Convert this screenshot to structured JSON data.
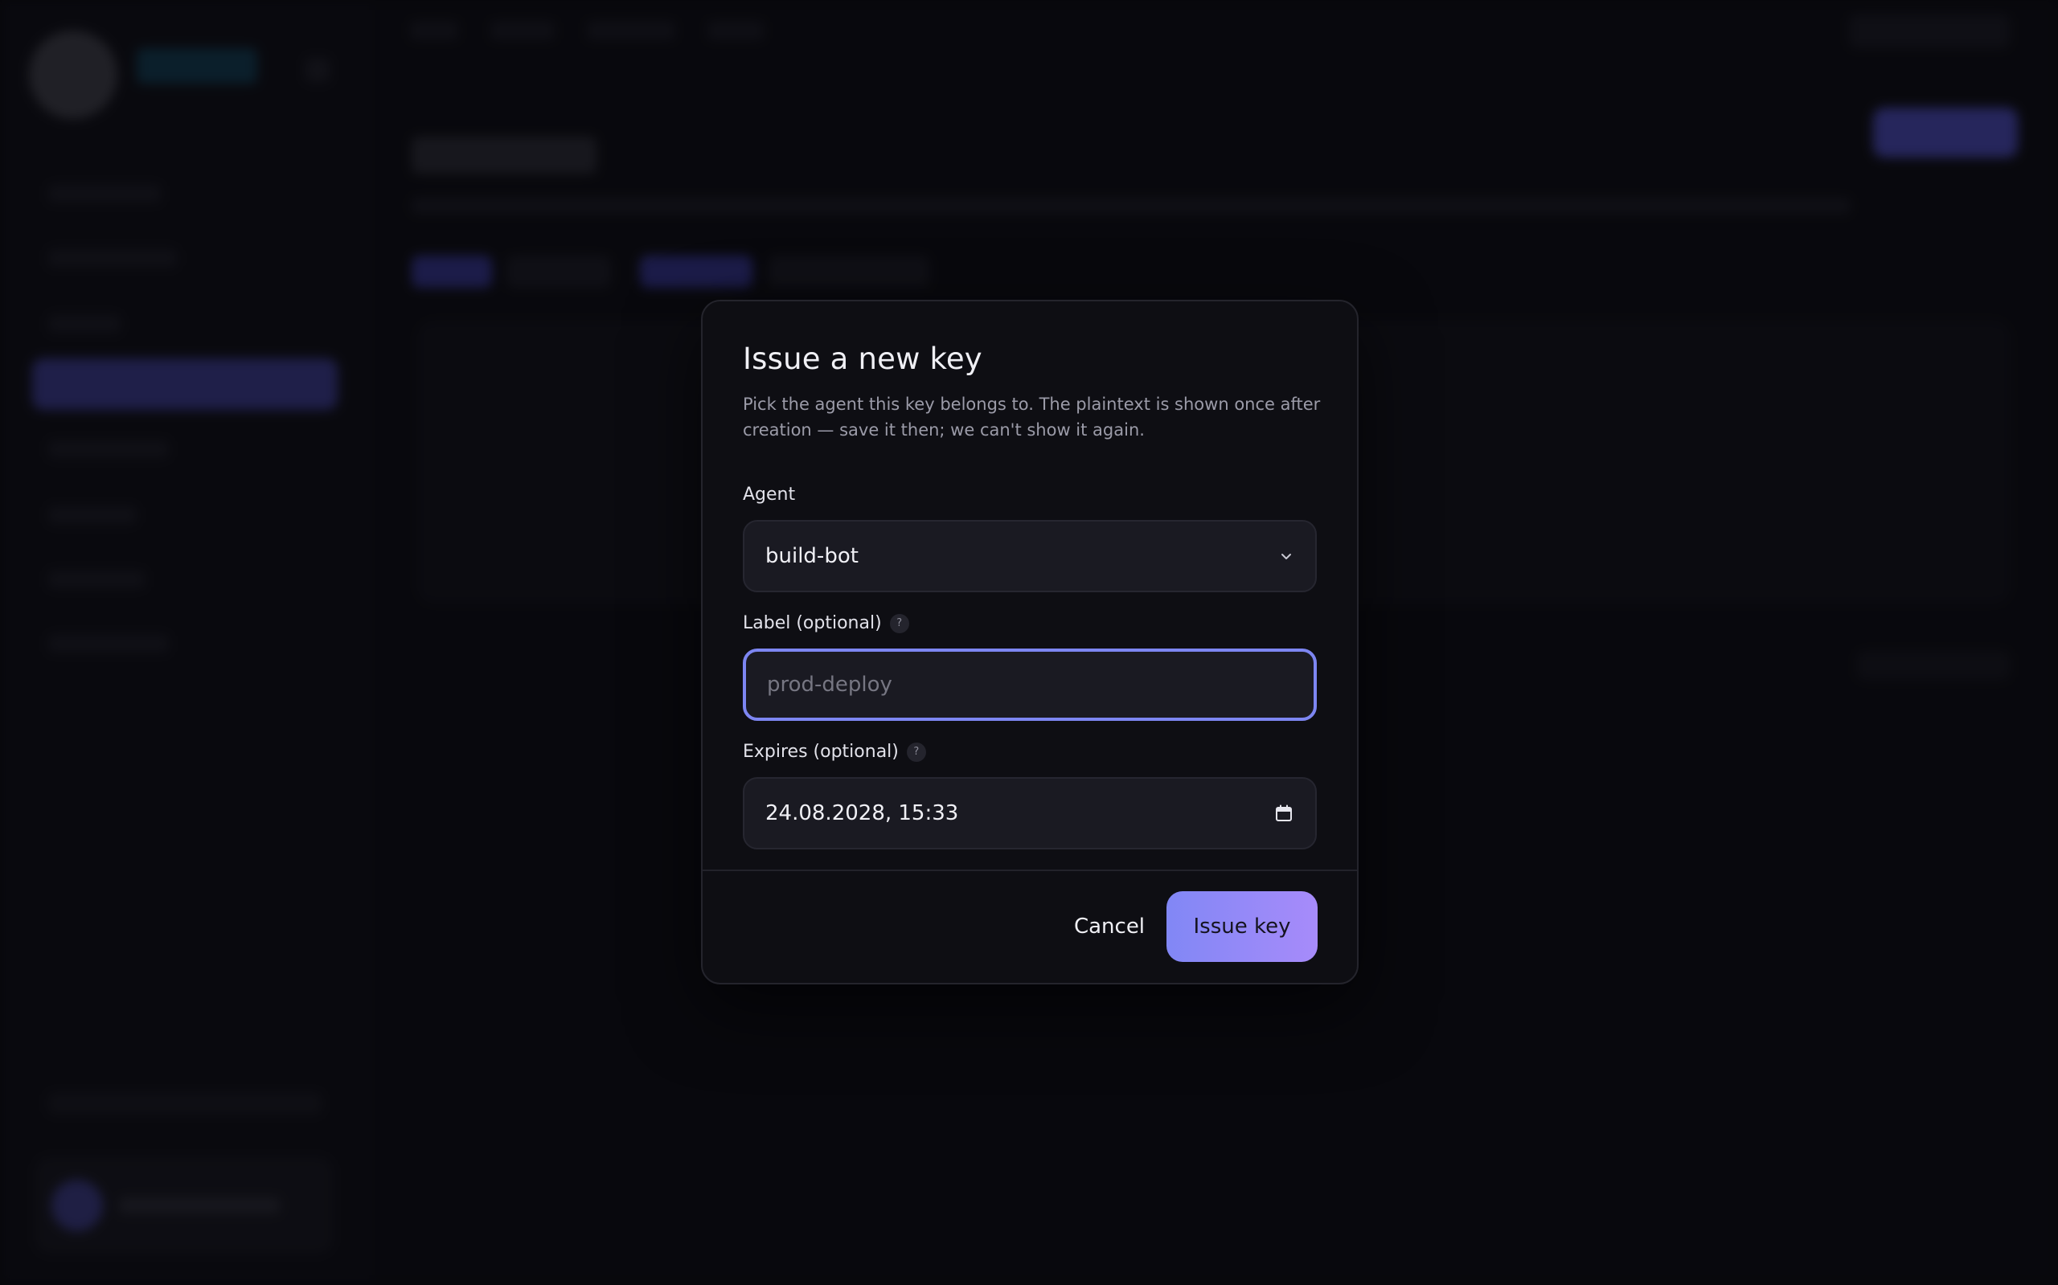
{
  "modal": {
    "title": "Issue a new key",
    "description": "Pick the agent this key belongs to. The plaintext is shown once after creation — save it then; we can't show it again.",
    "agent": {
      "label": "Agent",
      "selected": "build-bot",
      "icon": "chevron-down-icon"
    },
    "label_field": {
      "label": "Label (optional)",
      "placeholder": "prod-deploy",
      "value": "",
      "help": "?"
    },
    "expires_field": {
      "label": "Expires (optional)",
      "value": "24.08.2028, 15:33",
      "help": "?",
      "icon": "calendar-icon"
    },
    "buttons": {
      "cancel": "Cancel",
      "issue": "Issue key"
    }
  },
  "colors": {
    "accent_start": "#8187f5",
    "accent_end": "#a78bfa",
    "focus_ring": "#7d86f2",
    "modal_bg": "#0e0e13",
    "field_bg": "#1a1a22"
  }
}
